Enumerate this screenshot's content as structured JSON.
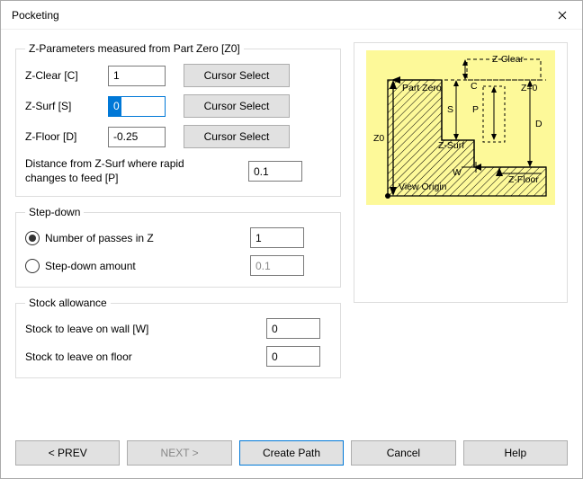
{
  "window": {
    "title": "Pocketing"
  },
  "zparams": {
    "legend": "Z-Parameters measured from Part Zero [Z0]",
    "zclear_label": "Z-Clear [C]",
    "zclear_value": "1",
    "zsurf_label": "Z-Surf [S]",
    "zsurf_value": "0",
    "zfloor_label": "Z-Floor [D]",
    "zfloor_value": "-0.25",
    "cursor_select": "Cursor Select",
    "rapid_label": "Distance from Z-Surf where rapid changes to feed [P]",
    "rapid_value": "0.1"
  },
  "stepdown": {
    "legend": "Step-down",
    "passes_label": "Number of passes in Z",
    "passes_value": "1",
    "amount_label": "Step-down amount",
    "amount_value": "0.1",
    "selected": "passes"
  },
  "stock": {
    "legend": "Stock allowance",
    "wall_label": "Stock to leave on wall [W]",
    "wall_value": "0",
    "floor_label": "Stock to leave on floor",
    "floor_value": "0"
  },
  "buttons": {
    "prev": "< PREV",
    "next": "NEXT >",
    "create": "Create Path",
    "cancel": "Cancel",
    "help": "Help"
  },
  "diagram": {
    "zclear": "Z-Clear",
    "partzero": "Part Zero",
    "c": "C",
    "z0_eq": "Z=0",
    "s": "S",
    "p": "P",
    "z0": "Z0",
    "zsurf": "Z-Surf",
    "d": "D",
    "w": "W",
    "vieworigin": "View Origin",
    "zfloor": "Z-Floor"
  }
}
